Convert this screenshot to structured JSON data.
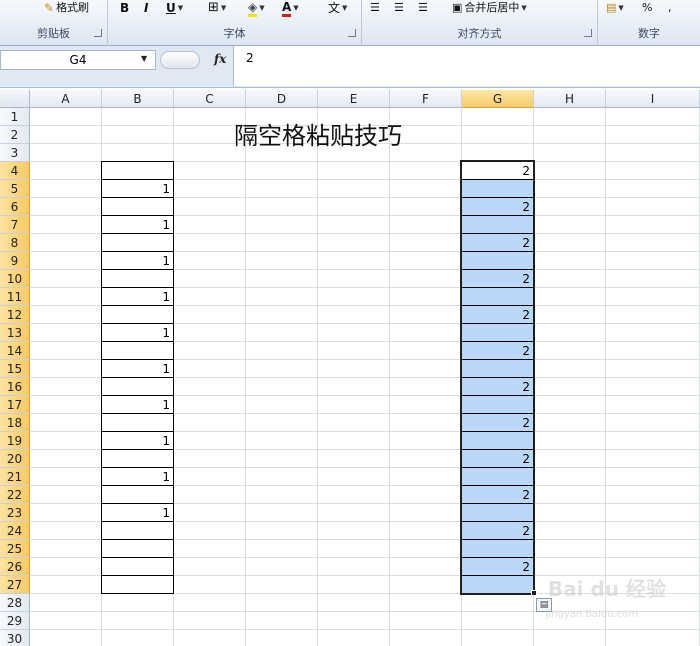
{
  "ribbon": {
    "groups": [
      {
        "label": "剪贴板"
      },
      {
        "label": "字体"
      },
      {
        "label": "对齐方式"
      },
      {
        "label": "数字"
      }
    ],
    "format_painter_label": "格式刷",
    "bold": "B",
    "italic": "I",
    "underline": "U",
    "font_color": "A",
    "wen": "文",
    "merge_label": "合并后居中",
    "percent": "%"
  },
  "formula_bar": {
    "name_box": "G4",
    "fx": "fx",
    "value": "2"
  },
  "sheet": {
    "columns": [
      "A",
      "B",
      "C",
      "D",
      "E",
      "F",
      "G",
      "H",
      "I"
    ],
    "selected_column": "G",
    "rows": [
      "1",
      "2",
      "3",
      "4",
      "5",
      "6",
      "7",
      "8",
      "9",
      "10",
      "11",
      "12",
      "13",
      "14",
      "15",
      "16",
      "17",
      "18",
      "19",
      "20",
      "21",
      "22",
      "23",
      "24",
      "25",
      "26",
      "27",
      "28",
      "29",
      "30"
    ],
    "title": "隔空格粘贴技巧",
    "b_values": [
      "",
      "1",
      "",
      "1",
      "",
      "1",
      "",
      "1",
      "",
      "1",
      "",
      "1",
      "",
      "1",
      "",
      "1",
      "",
      "1",
      "",
      "1",
      "",
      "",
      "",
      ""
    ],
    "g_values": [
      "2",
      "",
      "2",
      "",
      "2",
      "",
      "2",
      "",
      "2",
      "",
      "2",
      "",
      "2",
      "",
      "2",
      "",
      "2",
      "",
      "2",
      "",
      "2",
      "",
      "2",
      ""
    ],
    "selection_colors": {
      "highlight": "#b9d8f7",
      "header_selected": "#f8cd6a"
    }
  },
  "watermark": {
    "text": "Bai du 经验",
    "sub": "jingyan.baidu.com"
  }
}
